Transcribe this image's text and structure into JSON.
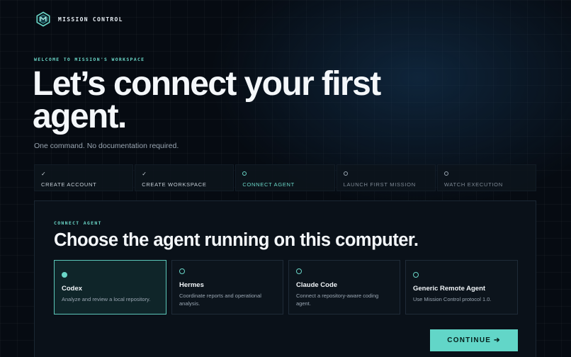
{
  "app": {
    "brand": "MISSION CONTROL",
    "logo_icon": "hexagon-logo-icon",
    "accent_color": "#62d6c8"
  },
  "hero": {
    "eyebrow": "WELCOME TO MISSION'S WORKSPACE",
    "title": "Let’s connect your first agent.",
    "subtitle": "One command. No documentation required."
  },
  "steps": [
    {
      "label": "CREATE ACCOUNT",
      "status": "done",
      "mark": "✓"
    },
    {
      "label": "CREATE WORKSPACE",
      "status": "done",
      "mark": "✓"
    },
    {
      "label": "CONNECT AGENT",
      "status": "current",
      "mark": ""
    },
    {
      "label": "LAUNCH FIRST MISSION",
      "status": "pending",
      "mark": ""
    },
    {
      "label": "WATCH EXECUTION",
      "status": "pending",
      "mark": ""
    }
  ],
  "connect": {
    "eyebrow": "CONNECT AGENT",
    "title": "Choose the agent running on this computer.",
    "agents": [
      {
        "name": "Codex",
        "description": "Analyze and review a local repository.",
        "selected": true
      },
      {
        "name": "Hermes",
        "description": "Coordinate reports and operational analysis.",
        "selected": false
      },
      {
        "name": "Claude Code",
        "description": "Connect a repository-aware coding agent.",
        "selected": false
      },
      {
        "name": "Generic Remote Agent",
        "description": "Use Mission Control protocol 1.0.",
        "selected": false
      }
    ],
    "continue_label": "CONTINUE ➔"
  }
}
